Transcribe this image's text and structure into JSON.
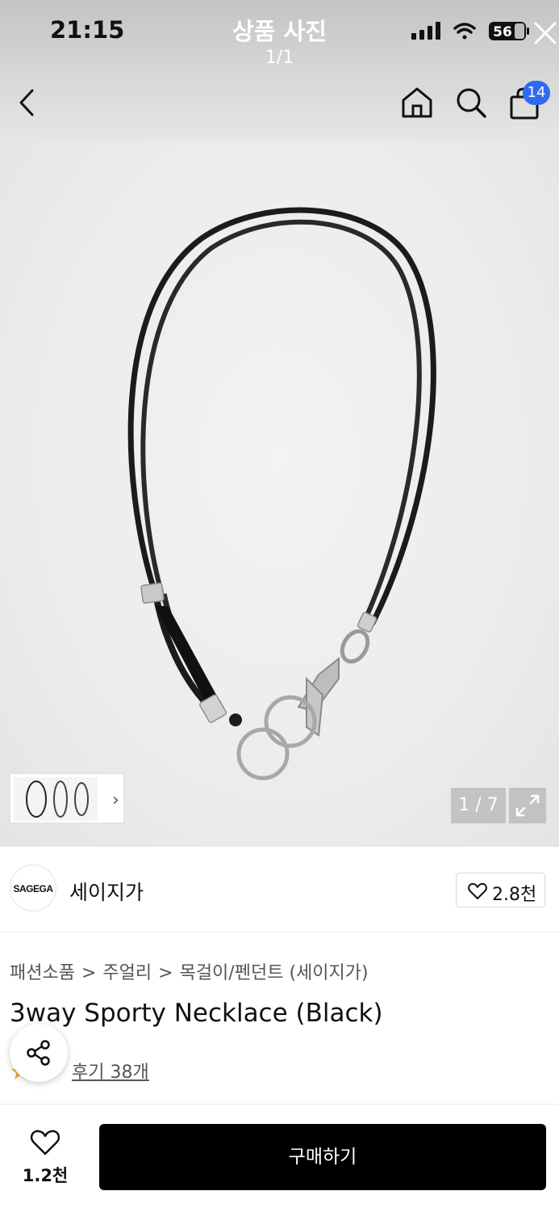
{
  "status_bar": {
    "time": "21:15",
    "battery": "56"
  },
  "overlay": {
    "title": "상품 사진",
    "counter": "1/1"
  },
  "nav": {
    "cart_badge": "14",
    "icons": [
      "back-icon",
      "home-icon",
      "search-icon",
      "shopping-bag-icon",
      "close-icon"
    ]
  },
  "gallery": {
    "page_counter": "1 / 7",
    "thumb_chevron": "›"
  },
  "brand": {
    "logo_text": "SAGEGA",
    "name": "세이지가",
    "like_count": "2.8천"
  },
  "product": {
    "breadcrumb": [
      "패션소품",
      "주얼리",
      "목걸이/펜던트",
      "(세이지가)"
    ],
    "breadcrumb_sep": ">",
    "title": "3way Sporty Necklace (Black)",
    "reviews": "후기 38개"
  },
  "bottom_bar": {
    "wish_count": "1.2천",
    "buy_label": "구매하기"
  },
  "colors": {
    "cart_badge": "#2f6af0",
    "buy_button": "#000000",
    "star": "#f5a623"
  }
}
